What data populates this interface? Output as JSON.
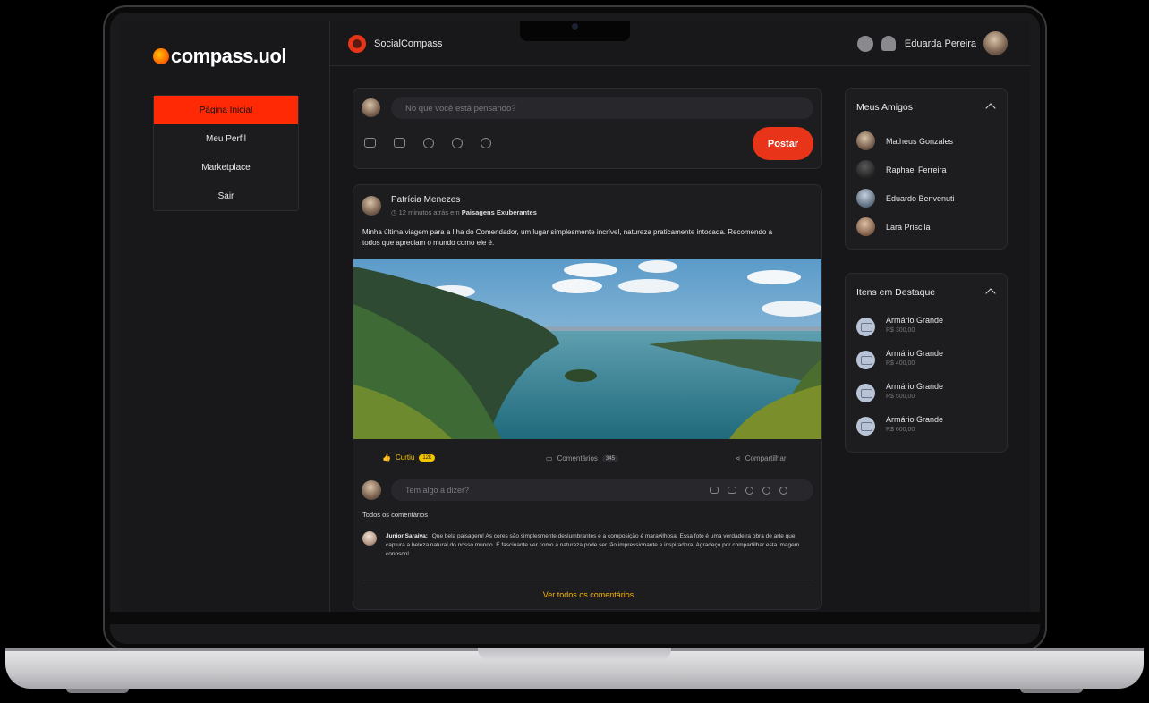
{
  "logo": {
    "brand": "compass",
    "suffix": ".uol"
  },
  "nav": {
    "items": [
      "Página Inicial",
      "Meu Perfil",
      "Marketplace",
      "Sair"
    ]
  },
  "header": {
    "app_name": "SocialCompass",
    "user_name": "Eduarda Pereira"
  },
  "composer": {
    "placeholder": "No que você está pensando?",
    "post_label": "Postar"
  },
  "post": {
    "author": "Patrícia Menezes",
    "time": "12 minutos atrás em",
    "location": "Paisagens Exuberantes",
    "text": "Minha última viagem para a Ilha do Comendador, um lugar simplesmente incrível, natureza praticamente intocada. Recomendo a todos que apreciam o mundo como ele é.",
    "like_label": "Curtiu",
    "like_count": "12k",
    "comments_label": "Comentários",
    "comments_count": "345",
    "share_label": "Compartilhar",
    "comment_placeholder": "Tem algo a dizer?",
    "all_comments_label": "Todos os comentários",
    "see_all_label": "Ver todos os comentários",
    "comments": [
      {
        "author": "Junior Saraiva:",
        "text": "Que bela paisagem! As cores são simplesmente deslumbrantes e a composição é maravilhosa. Essa foto é uma verdadeira obra de arte que captura a beleza natural do nosso mundo. É fascinante ver como a natureza pode ser tão impressionante e inspiradora. Agradeço por compartilhar esta imagem conosco!"
      }
    ]
  },
  "friends": {
    "title": "Meus Amigos",
    "items": [
      "Matheus Gonzales",
      "Raphael Ferreira",
      "Eduardo Benvenuti",
      "Lara Priscila"
    ]
  },
  "featured": {
    "title": "Itens em Destaque",
    "items": [
      {
        "name": "Armário Grande",
        "price": "R$ 300,00"
      },
      {
        "name": "Armário Grande",
        "price": "R$ 400,00"
      },
      {
        "name": "Armário Grande",
        "price": "R$ 500,00"
      },
      {
        "name": "Armário Grande",
        "price": "R$ 600,00"
      }
    ]
  },
  "colors": {
    "accent": "#e8351a",
    "active_nav": "#ff2a05",
    "like_badge": "#f5c400",
    "link": "#f5b400"
  }
}
